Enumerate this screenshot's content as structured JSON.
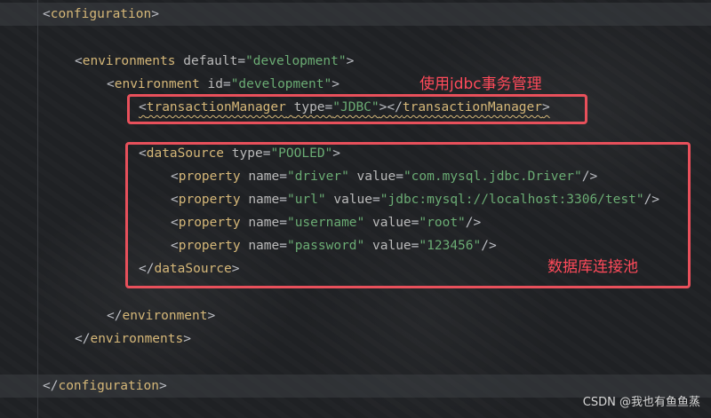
{
  "code": {
    "line_config_open": {
      "lt": "<",
      "tag": "configuration",
      "gt": ">"
    },
    "line_envs_open": {
      "lt": "<",
      "tag": "environments",
      "attr": "default",
      "eq": "=",
      "val": "\"development\"",
      "gt": ">"
    },
    "line_env_open": {
      "lt": "<",
      "tag": "environment",
      "attr": "id",
      "eq": "=",
      "val": "\"development\"",
      "gt": ">"
    },
    "line_tx": {
      "lt": "<",
      "tag": "transactionManager",
      "attr": "type",
      "eq": "=",
      "val": "\"JDBC\"",
      "mid": "></",
      "tag2": "transactionManager",
      "gt": ">"
    },
    "line_ds_open": {
      "lt": "<",
      "tag": "dataSource",
      "attr": "type",
      "eq": "=",
      "val": "\"POOLED\"",
      "gt": ">"
    },
    "properties": [
      {
        "lt": "<",
        "tag": "property",
        "a1": "name",
        "v1": "\"driver\"",
        "a2": "value",
        "v2": "\"com.mysql.jdbc.Driver\"",
        "end": "/>"
      },
      {
        "lt": "<",
        "tag": "property",
        "a1": "name",
        "v1": "\"url\"",
        "a2": "value",
        "v2": "\"jdbc:mysql://localhost:3306/test\"",
        "end": "/>"
      },
      {
        "lt": "<",
        "tag": "property",
        "a1": "name",
        "v1": "\"username\"",
        "a2": "value",
        "v2": "\"root\"",
        "end": "/>"
      },
      {
        "lt": "<",
        "tag": "property",
        "a1": "name",
        "v1": "\"password\"",
        "a2": "value",
        "v2": "\"123456\"",
        "end": "/>"
      }
    ],
    "eq": "=",
    "line_ds_close": {
      "lt": "</",
      "tag": "dataSource",
      "gt": ">"
    },
    "line_env_close": {
      "lt": "</",
      "tag": "environment",
      "gt": ">"
    },
    "line_envs_close": {
      "lt": "</",
      "tag": "environments",
      "gt": ">"
    },
    "line_config_close": {
      "lt": "</",
      "tag": "configuration",
      "gt": ">"
    }
  },
  "annotations": {
    "jdbc_tx": "使用jdbc事务管理",
    "pool": "数据库连接池"
  },
  "watermark": "CSDN @我也有鱼鱼蒸",
  "colors": {
    "tag": "#d5b778",
    "attr": "#bababa",
    "value": "#6aab73",
    "annotation": "#ff4a5a",
    "box": "#e8505b"
  }
}
